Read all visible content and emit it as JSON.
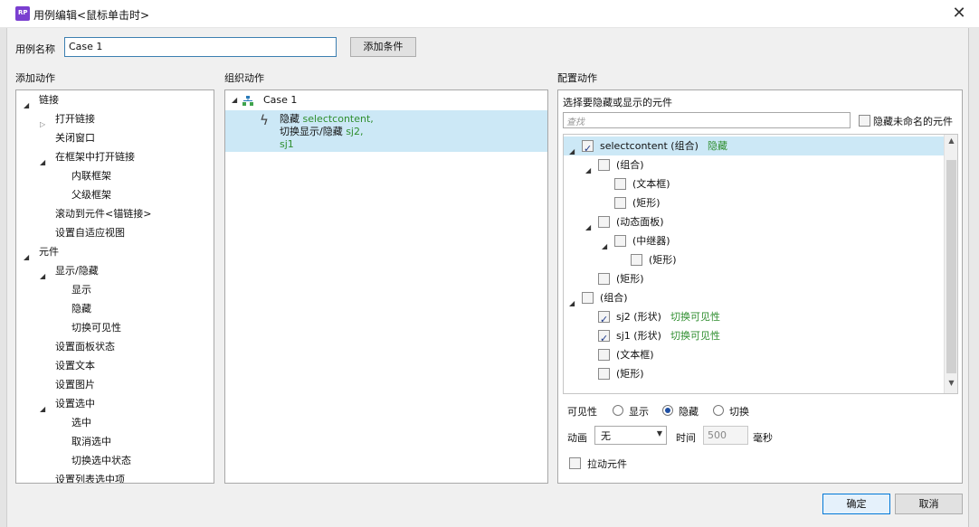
{
  "window": {
    "title": "用例编辑<鼠标单击时>",
    "app_icon_text": "RP"
  },
  "case_name": {
    "label": "用例名称",
    "value": "Case 1"
  },
  "add_condition_label": "添加条件",
  "sections": {
    "add_actions": "添加动作",
    "organize_actions": "组织动作",
    "configure_actions": "配置动作"
  },
  "add_actions_tree": [
    {
      "label": "链接",
      "indent": 0,
      "toggle": "open"
    },
    {
      "label": "打开链接",
      "indent": 1,
      "toggle": "closed"
    },
    {
      "label": "关闭窗口",
      "indent": 1,
      "toggle": "none"
    },
    {
      "label": "在框架中打开链接",
      "indent": 1,
      "toggle": "open"
    },
    {
      "label": "内联框架",
      "indent": 2,
      "toggle": "none"
    },
    {
      "label": "父级框架",
      "indent": 2,
      "toggle": "none"
    },
    {
      "label": "滚动到元件<锚链接>",
      "indent": 1,
      "toggle": "none"
    },
    {
      "label": "设置自适应视图",
      "indent": 1,
      "toggle": "none"
    },
    {
      "label": "元件",
      "indent": 0,
      "toggle": "open"
    },
    {
      "label": "显示/隐藏",
      "indent": 1,
      "toggle": "open"
    },
    {
      "label": "显示",
      "indent": 2,
      "toggle": "none"
    },
    {
      "label": "隐藏",
      "indent": 2,
      "toggle": "none"
    },
    {
      "label": "切换可见性",
      "indent": 2,
      "toggle": "none"
    },
    {
      "label": "设置面板状态",
      "indent": 1,
      "toggle": "none"
    },
    {
      "label": "设置文本",
      "indent": 1,
      "toggle": "none"
    },
    {
      "label": "设置图片",
      "indent": 1,
      "toggle": "none"
    },
    {
      "label": "设置选中",
      "indent": 1,
      "toggle": "open"
    },
    {
      "label": "选中",
      "indent": 2,
      "toggle": "none"
    },
    {
      "label": "取消选中",
      "indent": 2,
      "toggle": "none"
    },
    {
      "label": "切换选中状态",
      "indent": 2,
      "toggle": "none"
    },
    {
      "label": "设置列表选中项",
      "indent": 1,
      "toggle": "none"
    }
  ],
  "organize": {
    "case_label": "Case 1",
    "action_line1_prefix": "隐藏 ",
    "action_line1_target": "selectcontent,",
    "action_line2_prefix": "切换显示/隐藏 ",
    "action_line2_target": "sj2,",
    "action_line3_target": "sj1"
  },
  "configure": {
    "select_label": "选择要隐藏或显示的元件",
    "search_placeholder": "查找",
    "hide_unnamed_label": "隐藏未命名的元件",
    "hide_unnamed_checked": false,
    "widgets": [
      {
        "label": "selectcontent (组合)",
        "action": "隐藏",
        "indent": 0,
        "toggle": "open",
        "checked": true,
        "selected": true
      },
      {
        "label": "(组合)",
        "action": "",
        "indent": 1,
        "toggle": "open",
        "checked": false,
        "selected": false
      },
      {
        "label": "(文本框)",
        "action": "",
        "indent": 2,
        "toggle": "none",
        "checked": false,
        "selected": false
      },
      {
        "label": "(矩形)",
        "action": "",
        "indent": 2,
        "toggle": "none",
        "checked": false,
        "selected": false
      },
      {
        "label": "(动态面板)",
        "action": "",
        "indent": 1,
        "toggle": "open",
        "checked": false,
        "selected": false
      },
      {
        "label": "(中继器)",
        "action": "",
        "indent": 2,
        "toggle": "open",
        "checked": false,
        "selected": false
      },
      {
        "label": "(矩形)",
        "action": "",
        "indent": 3,
        "toggle": "none",
        "checked": false,
        "selected": false
      },
      {
        "label": "(矩形)",
        "action": "",
        "indent": 1,
        "toggle": "none",
        "checked": false,
        "selected": false
      },
      {
        "label": "(组合)",
        "action": "",
        "indent": 0,
        "toggle": "open",
        "checked": false,
        "selected": false
      },
      {
        "label": "sj2 (形状)",
        "action": "切换可见性",
        "indent": 1,
        "toggle": "none",
        "checked": true,
        "selected": false
      },
      {
        "label": "sj1 (形状)",
        "action": "切换可见性",
        "indent": 1,
        "toggle": "none",
        "checked": true,
        "selected": false
      },
      {
        "label": "(文本框)",
        "action": "",
        "indent": 1,
        "toggle": "none",
        "checked": false,
        "selected": false
      },
      {
        "label": "(矩形)",
        "action": "",
        "indent": 1,
        "toggle": "none",
        "checked": false,
        "selected": false
      }
    ],
    "visibility": {
      "label": "可见性",
      "options": [
        "显示",
        "隐藏",
        "切换"
      ],
      "selected": "隐藏"
    },
    "animation": {
      "label": "动画",
      "value": "无",
      "time_label": "时间",
      "time_value": "500",
      "time_unit": "毫秒"
    },
    "push_widgets_label": "拉动元件",
    "push_widgets_checked": false
  },
  "buttons": {
    "ok": "确定",
    "cancel": "取消"
  },
  "colors": {
    "action_green": "#2f8e2f",
    "selection_blue": "#cce8f6",
    "accent": "#0078d7"
  }
}
